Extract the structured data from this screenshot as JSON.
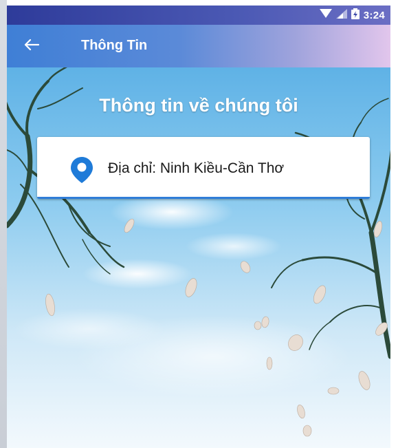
{
  "status_bar": {
    "time": "3:24",
    "icons": [
      "wifi-icon",
      "signal-icon",
      "battery-icon"
    ]
  },
  "app_bar": {
    "back_icon": "arrow-left-icon",
    "title": "Thông Tin"
  },
  "content": {
    "heading": "Thông tin về chúng tôi",
    "address_card": {
      "icon": "location-pin-icon",
      "text": "Địa chỉ: Ninh Kiều-Cần Thơ"
    }
  },
  "colors": {
    "status_bar": "#2e3b9a",
    "app_bar_start": "#3f7fd6",
    "app_bar_end": "#e2c6ec",
    "pin": "#1f7bd8",
    "card_accent": "#2f7dd8"
  }
}
